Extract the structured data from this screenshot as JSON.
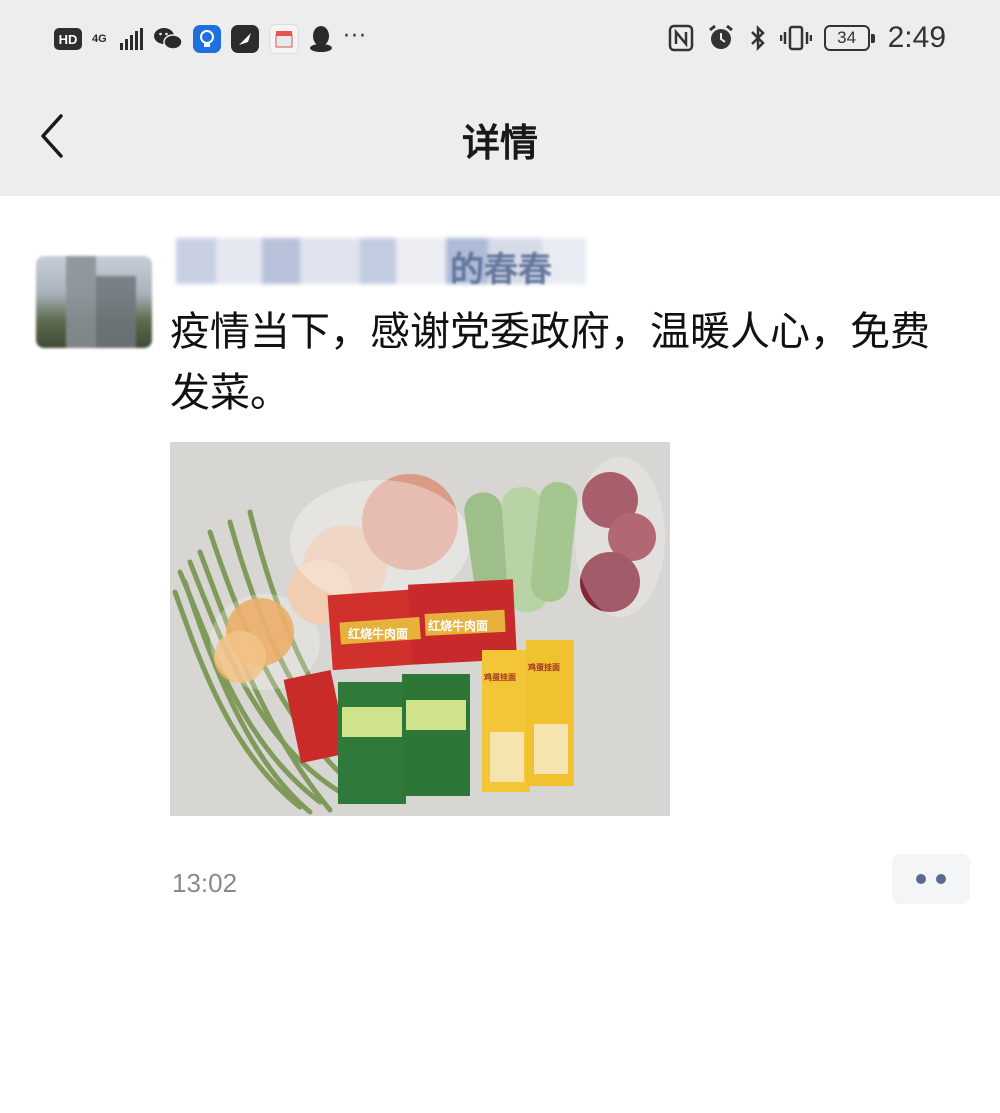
{
  "status_bar": {
    "hd_label": "HD",
    "network_label": "4G",
    "battery_level": "34",
    "time": "2:49",
    "more_indicator": "···",
    "icons": [
      "hd-icon",
      "signal-icon",
      "wechat-icon",
      "bulb-app-icon",
      "feather-app-icon",
      "taobao-app-icon",
      "qq-icon",
      "nfc-icon",
      "alarm-icon",
      "bluetooth-icon",
      "vibrate-icon",
      "battery-icon"
    ]
  },
  "nav": {
    "title": "详情",
    "back_icon": "chevron-left-icon"
  },
  "post": {
    "author_name_suffix": "的春春",
    "text": "疫情当下，感谢党委政府，温暖人心，免费发菜。",
    "timestamp": "13:02",
    "image": {
      "package_labels": [
        "红烧牛肉面",
        "红烧牛肉面",
        "鸡蛋挂面",
        "鸡蛋挂面"
      ]
    },
    "more_icon": "more-dots-icon"
  },
  "colors": {
    "header_bg": "#ededed",
    "link_blue": "#576b95",
    "timestamp_gray": "#8a8a8a"
  }
}
